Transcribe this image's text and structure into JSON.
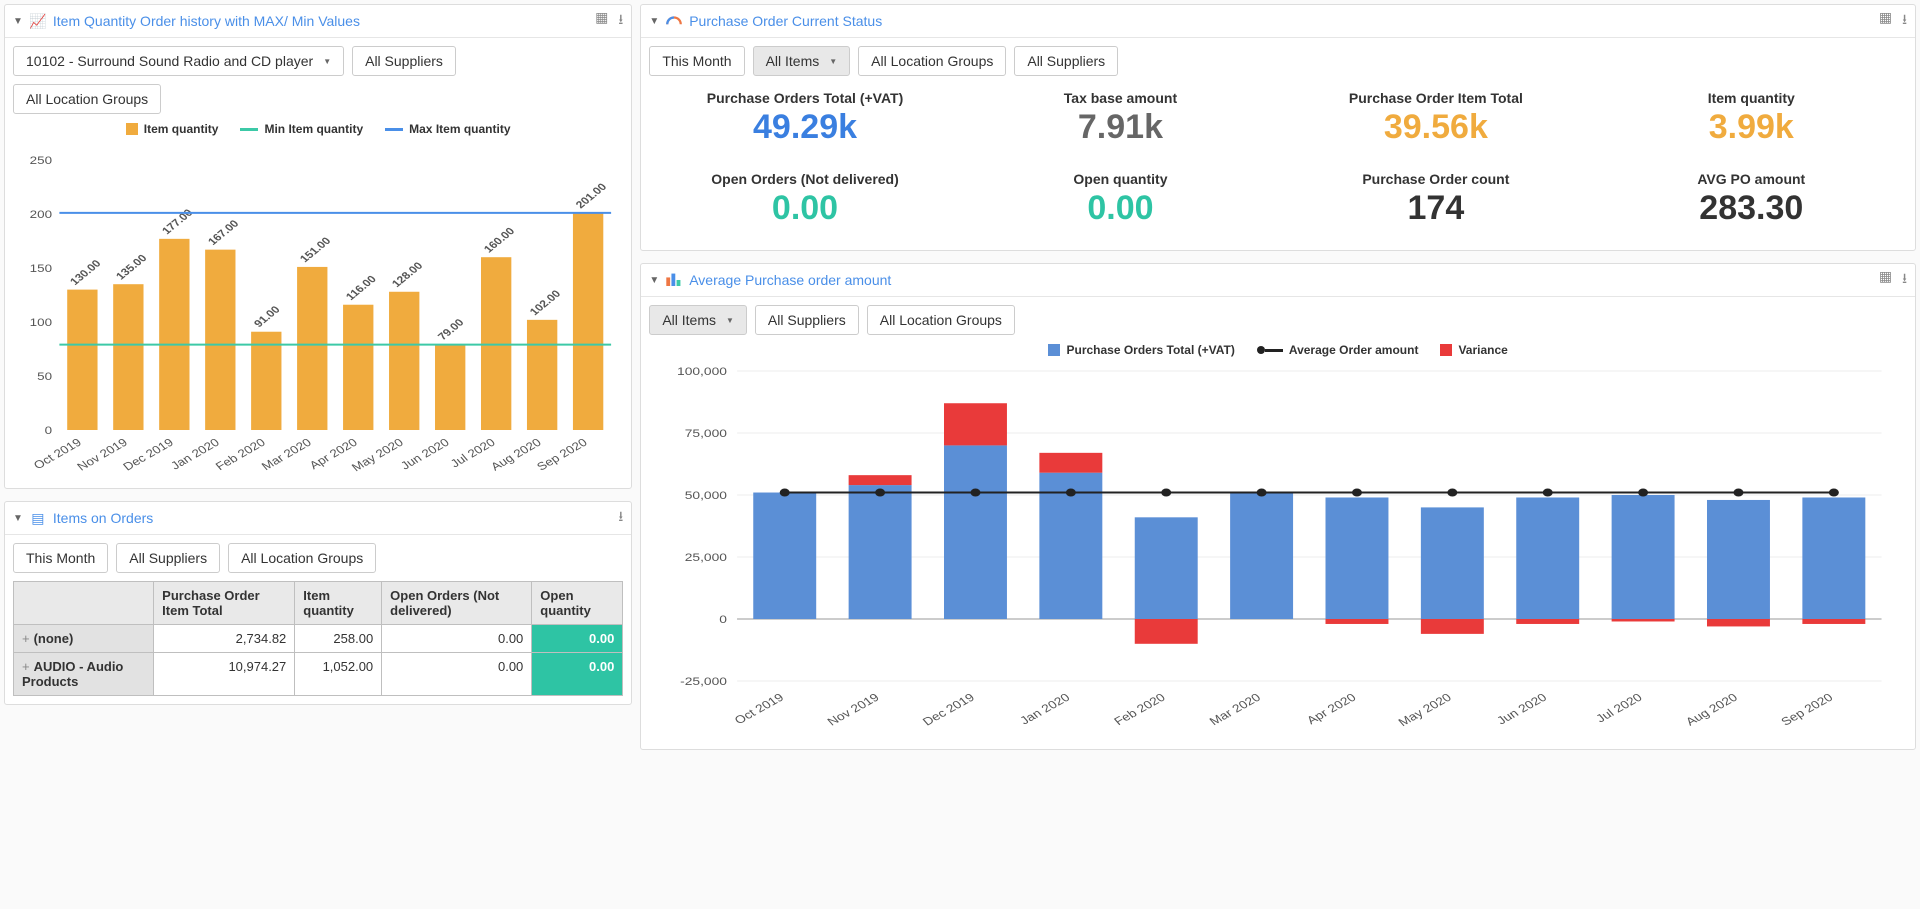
{
  "panels": {
    "itemQty": {
      "title": "Item Quantity Order history with MAX/ Min Values",
      "filters": [
        "10102 - Surround Sound Radio and CD player",
        "All Suppliers",
        "All Location Groups"
      ],
      "legend": [
        "Item quantity",
        "Min Item quantity",
        "Max Item quantity"
      ]
    },
    "poStatus": {
      "title": "Purchase Order Current Status",
      "filters": [
        "This Month",
        "All Items",
        "All Location Groups",
        "All Suppliers"
      ],
      "kpis": [
        {
          "label": "Purchase Orders Total (+VAT)",
          "value": "49.29k",
          "color": "#3a7fe0"
        },
        {
          "label": "Tax base amount",
          "value": "7.91k",
          "color": "#666"
        },
        {
          "label": "Purchase Order Item Total",
          "value": "39.56k",
          "color": "#f0ab3e"
        },
        {
          "label": "Item quantity",
          "value": "3.99k",
          "color": "#f0ab3e"
        },
        {
          "label": "Open Orders (Not delivered)",
          "value": "0.00",
          "color": "#2ec4a4"
        },
        {
          "label": "Open quantity",
          "value": "0.00",
          "color": "#2ec4a4"
        },
        {
          "label": "Purchase Order count",
          "value": "174",
          "color": "#333"
        },
        {
          "label": "AVG PO amount",
          "value": "283.30",
          "color": "#333"
        }
      ]
    },
    "avgPO": {
      "title": "Average Purchase order amount",
      "filters": [
        "All Items",
        "All Suppliers",
        "All Location Groups"
      ],
      "legend": [
        "Purchase Orders Total (+VAT)",
        "Average Order amount",
        "Variance"
      ]
    },
    "itemsOnOrders": {
      "title": "Items on Orders",
      "filters": [
        "This Month",
        "All Suppliers",
        "All Location Groups"
      ],
      "columns": [
        "",
        "Purchase Order Item Total",
        "Item quantity",
        "Open Orders (Not delivered)",
        "Open quantity"
      ],
      "rows": [
        {
          "name": "(none)",
          "c1": "2,734.82",
          "c2": "258.00",
          "c3": "0.00",
          "c4": "0.00"
        },
        {
          "name": "AUDIO - Audio Products",
          "c1": "10,974.27",
          "c2": "1,052.00",
          "c3": "0.00",
          "c4": "0.00"
        }
      ]
    }
  },
  "chart_data": [
    {
      "id": "item_quantity_history",
      "type": "bar",
      "title": "Item Quantity Order history with MAX/ Min Values",
      "categories": [
        "Oct 2019",
        "Nov 2019",
        "Dec 2019",
        "Jan 2020",
        "Feb 2020",
        "Mar 2020",
        "Apr 2020",
        "May 2020",
        "Jun 2020",
        "Jul 2020",
        "Aug 2020",
        "Sep 2020"
      ],
      "series": [
        {
          "name": "Item quantity",
          "type": "bar",
          "values": [
            130,
            135,
            177,
            167,
            91,
            151,
            116,
            128,
            79,
            160,
            102,
            201
          ]
        },
        {
          "name": "Min Item quantity",
          "type": "line",
          "values": [
            79,
            79,
            79,
            79,
            79,
            79,
            79,
            79,
            79,
            79,
            79,
            79
          ]
        },
        {
          "name": "Max Item quantity",
          "type": "line",
          "values": [
            201,
            201,
            201,
            201,
            201,
            201,
            201,
            201,
            201,
            201,
            201,
            201
          ]
        }
      ],
      "ylim": [
        0,
        250
      ],
      "yticks": [
        0,
        50,
        100,
        150,
        200,
        250
      ],
      "xlabel": "",
      "ylabel": ""
    },
    {
      "id": "avg_po_amount",
      "type": "bar",
      "title": "Average Purchase order amount",
      "categories": [
        "Oct 2019",
        "Nov 2019",
        "Dec 2019",
        "Jan 2020",
        "Feb 2020",
        "Mar 2020",
        "Apr 2020",
        "May 2020",
        "Jun 2020",
        "Jul 2020",
        "Aug 2020",
        "Sep 2020"
      ],
      "series": [
        {
          "name": "Purchase Orders Total (+VAT)",
          "type": "bar",
          "values": [
            51000,
            54000,
            70000,
            59000,
            41000,
            51000,
            49000,
            45000,
            49000,
            50000,
            48000,
            49000
          ]
        },
        {
          "name": "Variance",
          "type": "bar",
          "values": [
            0,
            4000,
            17000,
            8000,
            -10000,
            0,
            -2000,
            -6000,
            -2000,
            -1000,
            -3000,
            -2000
          ]
        },
        {
          "name": "Average Order amount",
          "type": "line",
          "values": [
            51000,
            51000,
            51000,
            51000,
            51000,
            51000,
            51000,
            51000,
            51000,
            51000,
            51000,
            51000
          ]
        }
      ],
      "ylim": [
        -25000,
        100000
      ],
      "yticks": [
        -25000,
        0,
        25000,
        50000,
        75000,
        100000
      ],
      "xlabel": "",
      "ylabel": ""
    }
  ]
}
